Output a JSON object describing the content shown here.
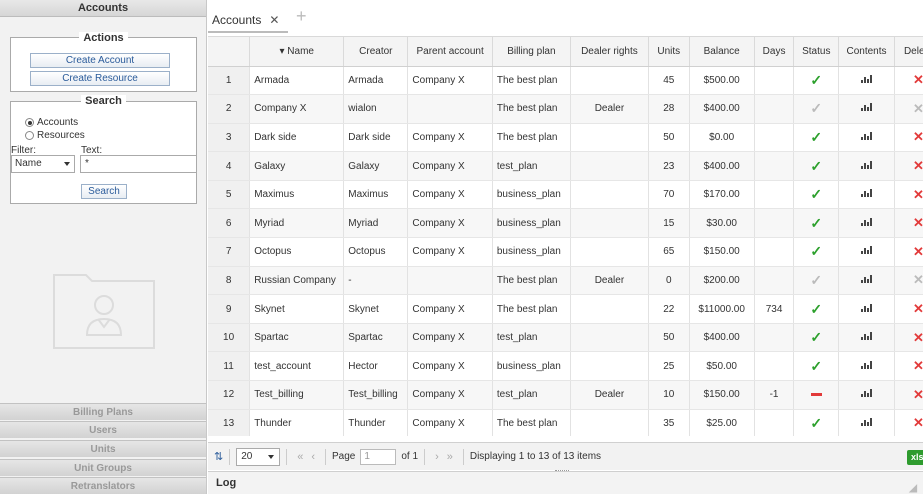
{
  "left": {
    "header": "Accounts",
    "actions": {
      "legend": "Actions",
      "create_account": "Create Account",
      "create_resource": "Create Resource"
    },
    "search": {
      "legend": "Search",
      "radio_accounts": "Accounts",
      "radio_resources": "Resources",
      "filter_label": "Filter:",
      "text_label": "Text:",
      "filter_value": "Name",
      "text_value": "*",
      "search_button": "Search"
    },
    "menu": [
      "Billing Plans",
      "Users",
      "Units",
      "Unit Groups",
      "Retranslators"
    ]
  },
  "tabs": {
    "active_label": "Accounts",
    "close_glyph": "✕",
    "add_glyph": "+"
  },
  "table": {
    "headers": {
      "name": "▾ Name",
      "creator": "Creator",
      "parent": "Parent account",
      "plan": "Billing plan",
      "dealer": "Dealer rights",
      "units": "Units",
      "balance": "Balance",
      "days": "Days",
      "status": "Status",
      "contents": "Contents",
      "delete": "Delete"
    },
    "rows": [
      {
        "n": "1",
        "name": "Armada",
        "creator": "Armada",
        "parent": "Company X",
        "plan": "The best plan",
        "dealer": "",
        "units": "45",
        "balance": "$500.00",
        "days": "",
        "status": "ok",
        "del": "active"
      },
      {
        "n": "2",
        "name": "Company X",
        "creator": "wialon",
        "parent": "",
        "plan": "The best plan",
        "dealer": "Dealer",
        "units": "28",
        "balance": "$400.00",
        "days": "",
        "status": "ok-dim",
        "del": "dim"
      },
      {
        "n": "3",
        "name": "Dark side",
        "creator": "Dark side",
        "parent": "Company X",
        "plan": "The best plan",
        "dealer": "",
        "units": "50",
        "balance": "$0.00",
        "days": "",
        "status": "ok",
        "del": "active"
      },
      {
        "n": "4",
        "name": "Galaxy",
        "creator": "Galaxy",
        "parent": "Company X",
        "plan": "test_plan",
        "dealer": "",
        "units": "23",
        "balance": "$400.00",
        "days": "",
        "status": "ok",
        "del": "active"
      },
      {
        "n": "5",
        "name": "Maximus",
        "creator": "Maximus",
        "parent": "Company X",
        "plan": "business_plan",
        "dealer": "",
        "units": "70",
        "balance": "$170.00",
        "days": "",
        "status": "ok",
        "del": "active"
      },
      {
        "n": "6",
        "name": "Myriad",
        "creator": "Myriad",
        "parent": "Company X",
        "plan": "business_plan",
        "dealer": "",
        "units": "15",
        "balance": "$30.00",
        "days": "",
        "status": "ok",
        "del": "active"
      },
      {
        "n": "7",
        "name": "Octopus",
        "creator": "Octopus",
        "parent": "Company X",
        "plan": "business_plan",
        "dealer": "",
        "units": "65",
        "balance": "$150.00",
        "days": "",
        "status": "ok",
        "del": "active"
      },
      {
        "n": "8",
        "name": "Russian Company",
        "creator": "-",
        "parent": "",
        "plan": "The best plan",
        "dealer": "Dealer",
        "units": "0",
        "balance": "$200.00",
        "days": "",
        "status": "ok-dim",
        "del": "dim"
      },
      {
        "n": "9",
        "name": "Skynet",
        "creator": "Skynet",
        "parent": "Company X",
        "plan": "The best plan",
        "dealer": "",
        "units": "22",
        "balance": "$11000.00",
        "days": "734",
        "status": "ok",
        "del": "active"
      },
      {
        "n": "10",
        "name": "Spartac",
        "creator": "Spartac",
        "parent": "Company X",
        "plan": "test_plan",
        "dealer": "",
        "units": "50",
        "balance": "$400.00",
        "days": "",
        "status": "ok",
        "del": "active"
      },
      {
        "n": "11",
        "name": "test_account",
        "creator": "Hector",
        "parent": "Company X",
        "plan": "business_plan",
        "dealer": "",
        "units": "25",
        "balance": "$50.00",
        "days": "",
        "status": "ok",
        "del": "active"
      },
      {
        "n": "12",
        "name": "Test_billing",
        "creator": "Test_billing",
        "parent": "Company X",
        "plan": "test_plan",
        "dealer": "Dealer",
        "units": "10",
        "balance": "$150.00",
        "days": "-1",
        "status": "blocked",
        "del": "active"
      },
      {
        "n": "13",
        "name": "Thunder",
        "creator": "Thunder",
        "parent": "Company X",
        "plan": "The best plan",
        "dealer": "",
        "units": "35",
        "balance": "$25.00",
        "days": "",
        "status": "ok",
        "del": "active"
      }
    ]
  },
  "pager": {
    "page_size": "20",
    "page_label": "Page",
    "page_value": "1",
    "of_label": "of 1",
    "summary": "Displaying 1 to 13 of 13 items",
    "export_label": "xlsx"
  },
  "log": {
    "label": "Log"
  },
  "colors": {
    "ok": "#2ca02c",
    "danger": "#e23a3a",
    "link": "#2a5b9a",
    "export": "#2e9b2e"
  }
}
